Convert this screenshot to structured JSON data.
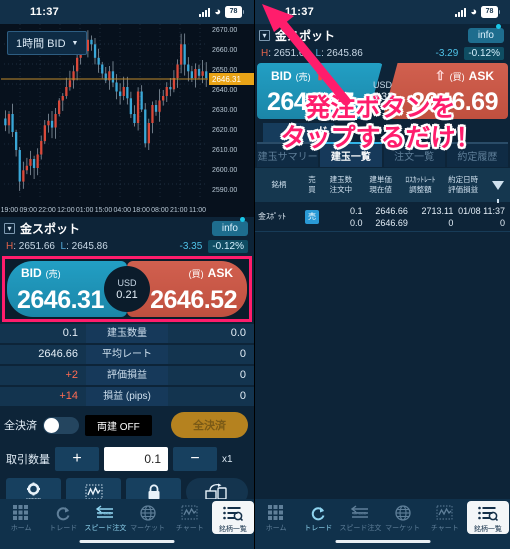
{
  "status_bar": {
    "time": "11:37",
    "battery": "78"
  },
  "left": {
    "chart": {
      "timeframe_label": "1時間 BID",
      "price_tag": "2646.31"
    },
    "instrument": {
      "name": "金スポット",
      "info_label": "info",
      "high_label": "H",
      "high": "2651.66",
      "low_label": "L",
      "low": "2645.86",
      "change": "-3.35",
      "change_pct": "-0.12%"
    },
    "quote": {
      "bid_label": "BID",
      "bid_sub": "(売)",
      "bid_price": "2646.31",
      "ask_label": "ASK",
      "ask_sub": "(買)",
      "ask_price": "2646.52",
      "spread_ccy": "USD",
      "spread_value": "0.21"
    },
    "positions": [
      {
        "sell": "0.1",
        "label": "建玉数量",
        "buy": "0.0"
      },
      {
        "sell": "2646.66",
        "label": "平均レート",
        "buy": "0"
      },
      {
        "sell": "+2",
        "label": "評価損益",
        "buy": "0",
        "pl": true
      },
      {
        "sell": "+14",
        "label": "損益 (pips)",
        "buy": "0",
        "pl": true
      }
    ],
    "settle": {
      "toggle_label": "全決済",
      "ryodate_label": "両建 OFF",
      "button_label": "全決済"
    },
    "quantity": {
      "label": "取引数量",
      "plus": "+",
      "value": "0.1",
      "minus": "−",
      "multiplier": "x1"
    },
    "icon_buttons": [
      "speed-settings-icon",
      "chart-icon",
      "lock-icon",
      "device-transfer-icon"
    ]
  },
  "right": {
    "instrument": {
      "name": "金スポット",
      "info_label": "info",
      "high_label": "H",
      "high": "2651.66",
      "low_label": "L",
      "low": "2645.86",
      "change": "-3.29",
      "change_pct": "-0.12%"
    },
    "quote": {
      "bid_label": "BID",
      "bid_sub": "(売)",
      "bid_price": "2646.37",
      "ask_label": "ASK",
      "ask_sub": "(買)",
      "ask_price": "2646.69",
      "spread_ccy": "USD",
      "spread_value": "0.32"
    },
    "trade_tab": "トレード",
    "sub_tabs": [
      {
        "label": "建玉サマリー",
        "active": false
      },
      {
        "label": "建玉一覧",
        "active": true
      },
      {
        "label": "注文一覧",
        "active": false
      },
      {
        "label": "約定履歴",
        "active": false
      }
    ],
    "table": {
      "headers": {
        "name": "銘柄",
        "side": "売\n買",
        "qty": "建玉数\n注文中",
        "price": "建単価\n現在値",
        "loss": "ﾛｽｶｯﾄﾚｰﾄ\n調整額",
        "date": "約定日時\n評価損益"
      },
      "rows": [
        {
          "name": "金ｽﾎﾟｯﾄ",
          "side": "売",
          "qty_top": "0.1",
          "qty_bottom": "0.0",
          "price_top": "2646.66",
          "price_bottom": "2646.69",
          "loss_top": "2713.11",
          "loss_bottom": "0",
          "date_top": "01/08 11:37",
          "date_bottom": "0"
        }
      ]
    },
    "annotation": {
      "line1": "発注ボタンを",
      "line2": "タップするだけ！"
    }
  },
  "bottom_nav_left": [
    {
      "label": "ホーム",
      "icon": "home-grid-icon",
      "state": "inactive"
    },
    {
      "label": "トレード",
      "icon": "trade-refresh-icon",
      "state": "inactive"
    },
    {
      "label": "スピード注文",
      "icon": "speed-order-icon",
      "state": "active"
    },
    {
      "label": "マーケット",
      "icon": "market-globe-icon",
      "state": "inactive"
    },
    {
      "label": "チャート",
      "icon": "chart-icon",
      "state": "inactive"
    },
    {
      "label": "銘柄一覧",
      "icon": "list-search-icon",
      "state": "selected"
    }
  ],
  "bottom_nav_right": [
    {
      "label": "ホーム",
      "icon": "home-grid-icon",
      "state": "inactive"
    },
    {
      "label": "トレード",
      "icon": "trade-refresh-icon",
      "state": "active"
    },
    {
      "label": "スピード注文",
      "icon": "speed-order-icon",
      "state": "inactive"
    },
    {
      "label": "マーケット",
      "icon": "market-globe-icon",
      "state": "inactive"
    },
    {
      "label": "チャート",
      "icon": "chart-icon",
      "state": "inactive"
    },
    {
      "label": "銘柄一覧",
      "icon": "list-search-icon",
      "state": "selected"
    }
  ],
  "chart_data": {
    "type": "line",
    "title": "",
    "xlabel": "",
    "ylabel": "",
    "ylim": [
      2590,
      2670
    ],
    "yticks": [
      "2590.00",
      "2600.00",
      "2610.00",
      "2620.00",
      "2630.00",
      "2640.00",
      "2650.00",
      "2660.00",
      "2670.00"
    ],
    "xticks": [
      "19:00",
      "09:00",
      "22:00",
      "12:00",
      "01:00",
      "15:00",
      "04:00",
      "18:00",
      "08:00",
      "21:00",
      "11:00"
    ],
    "current_price": 2646.31,
    "values": [
      2628,
      2625,
      2630,
      2622,
      2614,
      2600,
      2605,
      2607,
      2610,
      2606,
      2612,
      2618,
      2625,
      2627,
      2624,
      2630,
      2636,
      2638,
      2642,
      2645,
      2649,
      2655,
      2660,
      2658,
      2663,
      2661,
      2655,
      2652,
      2648,
      2645,
      2649,
      2644,
      2640,
      2638,
      2642,
      2637,
      2630,
      2626,
      2640,
      2632,
      2617,
      2626,
      2634,
      2631,
      2636,
      2638,
      2642,
      2641,
      2646,
      2652,
      2661,
      2652,
      2649,
      2646,
      2650,
      2647,
      2649,
      2646
    ]
  }
}
